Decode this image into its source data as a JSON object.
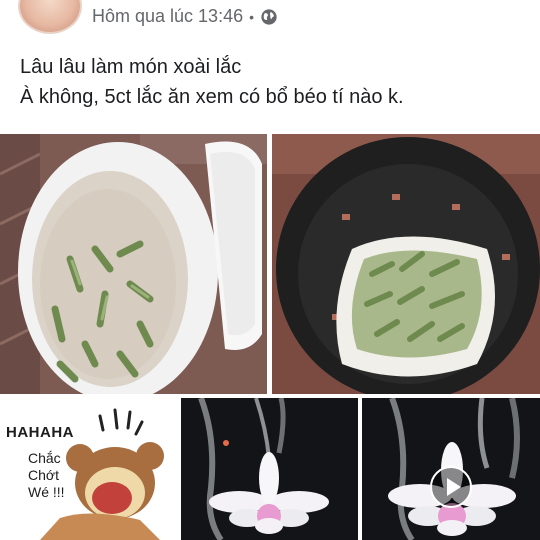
{
  "post": {
    "timestamp": "Hôm qua lúc 13:46",
    "separator": "•",
    "privacy_icon": "globe-icon",
    "text_lines": [
      "Lâu lâu làm món xoài lắc",
      "À không, 5ct lắc ăn xem có bổ béo tí nào k."
    ]
  },
  "media": {
    "meme": {
      "laugh": "HAHAHA",
      "caption_lines": [
        "Chắc",
        "Chớt",
        "Wé !!!"
      ]
    },
    "video_icon": "play-icon"
  }
}
